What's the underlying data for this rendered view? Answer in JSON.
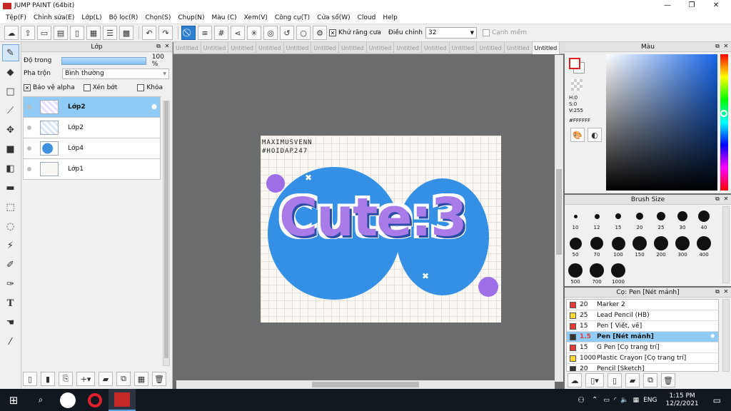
{
  "title": "JUMP PAINT (64bit)",
  "window_controls": {
    "minimize": "—",
    "maximize": "❐",
    "close": "✕"
  },
  "menu": [
    "Tệp(F)",
    "Chỉnh sửa(E)",
    "Lớp(L)",
    "Bộ lọc(R)",
    "Chọn(S)",
    "Chụp(N)",
    "Màu (C)",
    "Xem(V)",
    "Công cụ(T)",
    "Cửa sổ(W)",
    "Cloud",
    "Help"
  ],
  "toolbar": {
    "antialias": "Khử răng cưa",
    "adjust": "Điều chỉnh",
    "adjust_value": "32",
    "snap": "Cạnh mềm"
  },
  "layer_panel": {
    "title": "Lớp",
    "opacity_label": "Độ trong",
    "opacity_value": "100 %",
    "opacity_fraction": 1.0,
    "blend_label": "Pha trộn",
    "blend_value": "Bình thường",
    "protect_alpha": "Bảo vệ alpha",
    "clip": "Xén bớt",
    "lock": "Khóa",
    "layers": [
      {
        "name": "Lớp2",
        "selected": true
      },
      {
        "name": "Lớp2",
        "selected": false
      },
      {
        "name": "Lớp4",
        "selected": false
      },
      {
        "name": "Lớp1",
        "selected": false
      }
    ]
  },
  "doc_tabs": [
    "Untitled",
    "Untitled",
    "Untitled",
    "Untitled",
    "Untitled",
    "Untitled",
    "Untitled",
    "Untitled",
    "Untitled",
    "Untitled",
    "Untitled",
    "Untitled",
    "Untitled",
    "Untitled"
  ],
  "artwork": {
    "signature_line1": "MAXIMUSVENN",
    "signature_line2": "#HOIDAP247",
    "main_text": "Cute:3"
  },
  "color_panel": {
    "title": "Màu",
    "h": "H:0",
    "s": "S:0",
    "v": "V:255",
    "hex": "#FFFFFF"
  },
  "brush_panel": {
    "title": "Brush Size",
    "sizes": [
      "10",
      "12",
      "15",
      "20",
      "25",
      "30",
      "40",
      "50",
      "70",
      "100",
      "150",
      "200",
      "300",
      "400",
      "500",
      "700",
      "1000"
    ]
  },
  "pen_panel": {
    "title": "Cọ: Pen [Nét mảnh]",
    "items": [
      {
        "size": "20",
        "name": "Marker 2",
        "color": "#e53935"
      },
      {
        "size": "25",
        "name": "Lead Pencil (HB)",
        "color": "#fdd835"
      },
      {
        "size": "15",
        "name": "Pen [ Viết, vẽ]",
        "color": "#e53935"
      },
      {
        "size": "1.5",
        "name": "Pen [Nét mảnh]",
        "color": "#333333",
        "selected": true
      },
      {
        "size": "15",
        "name": "G Pen [Cọ trang trí]",
        "color": "#e53935"
      },
      {
        "size": "1000",
        "name": "Plastic Crayon [Cọ trang trí]",
        "color": "#fdd835"
      },
      {
        "size": "20",
        "name": "Pencil [Sketch]",
        "color": "#333333"
      }
    ]
  },
  "taskbar": {
    "lang": "ENG",
    "time": "1:15 PM",
    "date": "12/2/2021"
  }
}
